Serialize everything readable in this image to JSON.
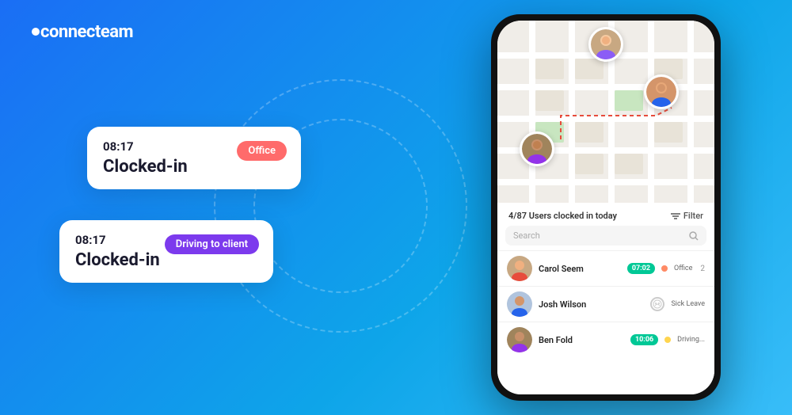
{
  "logo": {
    "text": "connecteam"
  },
  "card1": {
    "time": "08:17",
    "status": "Clocked-in",
    "badge": "Office",
    "badge_color": "#ff6b6b"
  },
  "card2": {
    "time": "08:17",
    "status": "Clocked-in",
    "badge": "Driving to client",
    "badge_color": "#7c3aed"
  },
  "phone": {
    "map": {
      "users_count": "4/87 Users clocked in today",
      "filter_label": "Filter"
    },
    "search": {
      "placeholder": "Search"
    },
    "users": [
      {
        "name": "Carol Seem",
        "time": "07:02",
        "status_type": "dot",
        "status_color": "#ff8a65",
        "status_label": "Office",
        "count": "2"
      },
      {
        "name": "Josh Wilson",
        "time": "",
        "status_type": "icon",
        "status_label": "Sick Leave",
        "count": ""
      },
      {
        "name": "Ben Fold",
        "time": "10:06",
        "status_type": "dot",
        "status_color": "#ffd54f",
        "status_label": "Driving...",
        "count": ""
      }
    ]
  }
}
